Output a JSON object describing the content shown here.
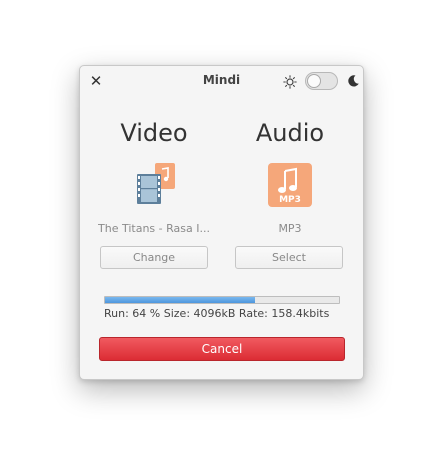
{
  "window": {
    "title": "Mindi",
    "close_icon": "close-icon",
    "theme": {
      "sun_icon": "sun-icon",
      "moon_icon": "moon-icon",
      "dark_mode_enabled": false
    }
  },
  "video": {
    "heading": "Video",
    "icon": "video-file-icon",
    "file_name": "The Titans - Rasa I...",
    "button_label": "Change"
  },
  "audio": {
    "heading": "Audio",
    "icon": "mp3-file-icon",
    "format": "MP3",
    "icon_label": "MP3",
    "button_label": "Select"
  },
  "progress": {
    "fraction": 0.64,
    "status": "Run: 64 %  Size: 4096kB Rate: 158.4kbits"
  },
  "actions": {
    "cancel_label": "Cancel"
  },
  "colors": {
    "accent_red": "#e2333b",
    "progress_blue": "#5da3e5",
    "file_icon_orange": "#f5a77a"
  }
}
